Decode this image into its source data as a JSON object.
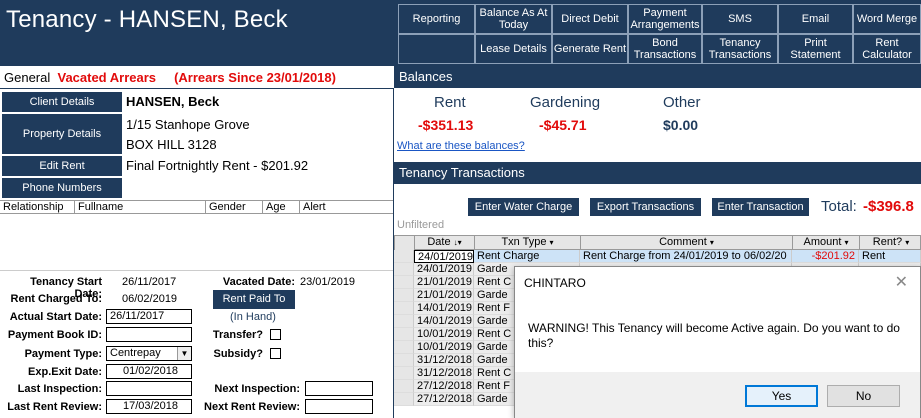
{
  "header": {
    "title": "Tenancy - HANSEN, Beck",
    "toolbar_row1": [
      "Reporting",
      "Balance As At Today",
      "Direct Debit",
      "Payment Arrangements",
      "SMS",
      "Email",
      "Word Merge"
    ],
    "toolbar_row2": [
      "",
      "Lease Details",
      "Generate Rent",
      "Bond Transactions",
      "Tenancy Transactions",
      "Print Statement",
      "Rent Calculator"
    ]
  },
  "general": {
    "label": "General",
    "status": "Vacated Arrears",
    "arrears_since": "(Arrears Since 23/01/2018)"
  },
  "client": {
    "buttons": [
      "Client Details",
      "Property Details",
      "Edit Rent",
      "Phone Numbers"
    ],
    "name": "HANSEN, Beck",
    "address1": "1/15 Stanhope Grove",
    "address2": "BOX HILL 3128",
    "rent": "Final Fortnightly Rent - $201.92"
  },
  "occupants": {
    "columns": [
      "Relationship",
      "Fullname",
      "Gender",
      "Age",
      "Alert"
    ]
  },
  "tenancy": {
    "start_label": "Tenancy Start Date:",
    "start": "26/11/2017",
    "vacated_label": "Vacated Date:",
    "vacated": "23/01/2019",
    "charged_label": "Rent Charged To:",
    "charged": "06/02/2019",
    "paid_button": "Rent Paid To",
    "in_hand": "(In Hand)",
    "actual_label": "Actual Start Date:",
    "actual": "26/11/2017",
    "book_label": "Payment Book ID:",
    "book": "",
    "transfer_label": "Transfer?",
    "ptype_label": "Payment Type:",
    "ptype": "Centrepay",
    "subsidy_label": "Subsidy?",
    "exit_label": "Exp.Exit Date:",
    "exit": "01/02/2018",
    "last_insp_label": "Last Inspection:",
    "last_insp": "",
    "next_insp_label": "Next Inspection:",
    "next_insp": "",
    "last_review_label": "Last Rent Review:",
    "last_review": "17/03/2018",
    "next_review_label": "Next Rent Review:",
    "next_review": ""
  },
  "balances": {
    "heading": "Balances",
    "items": [
      {
        "name": "Rent",
        "amount": "-$351.13"
      },
      {
        "name": "Gardening",
        "amount": "-$45.71"
      },
      {
        "name": "Other",
        "amount": "$0.00"
      }
    ],
    "link": "What are these balances?"
  },
  "transactions": {
    "heading": "Tenancy Transactions",
    "buttons": [
      "Enter Water Charge",
      "Export Transactions",
      "Enter Transaction"
    ],
    "total_label": "Total:",
    "total": "-$396.8",
    "filter": "Unfiltered",
    "columns": [
      "Date",
      "Txn Type",
      "Comment",
      "Amount",
      "Rent?"
    ],
    "rows": [
      {
        "date": "24/01/2019",
        "type": "Rent Charge",
        "comment": "Rent Charge from 24/01/2019 to 06/02/20",
        "amount": "-$201.92",
        "rent": "Rent"
      },
      {
        "date": "24/01/2019",
        "type": "Garde",
        "comment": "",
        "amount": "",
        "rent": ""
      },
      {
        "date": "21/01/2019",
        "type": "Rent C",
        "comment": "",
        "amount": "",
        "rent": ""
      },
      {
        "date": "21/01/2019",
        "type": "Garde",
        "comment": "",
        "amount": "",
        "rent": ""
      },
      {
        "date": "14/01/2019",
        "type": "Rent F",
        "comment": "",
        "amount": "",
        "rent": ""
      },
      {
        "date": "14/01/2019",
        "type": "Garde",
        "comment": "",
        "amount": "",
        "rent": ""
      },
      {
        "date": "10/01/2019",
        "type": "Rent C",
        "comment": "",
        "amount": "",
        "rent": ""
      },
      {
        "date": "10/01/2019",
        "type": "Garde",
        "comment": "",
        "amount": "",
        "rent": ""
      },
      {
        "date": "31/12/2018",
        "type": "Garde",
        "comment": "",
        "amount": "",
        "rent": ""
      },
      {
        "date": "31/12/2018",
        "type": "Rent C",
        "comment": "",
        "amount": "",
        "rent": ""
      },
      {
        "date": "27/12/2018",
        "type": "Rent F",
        "comment": "",
        "amount": "",
        "rent": ""
      },
      {
        "date": "27/12/2018",
        "type": "Garde",
        "comment": "",
        "amount": "",
        "rent": ""
      }
    ]
  },
  "dialog": {
    "title": "CHINTARO",
    "message": "WARNING!  This Tenancy will become Active again. Do you want to do this?",
    "yes": "Yes",
    "no": "No"
  }
}
